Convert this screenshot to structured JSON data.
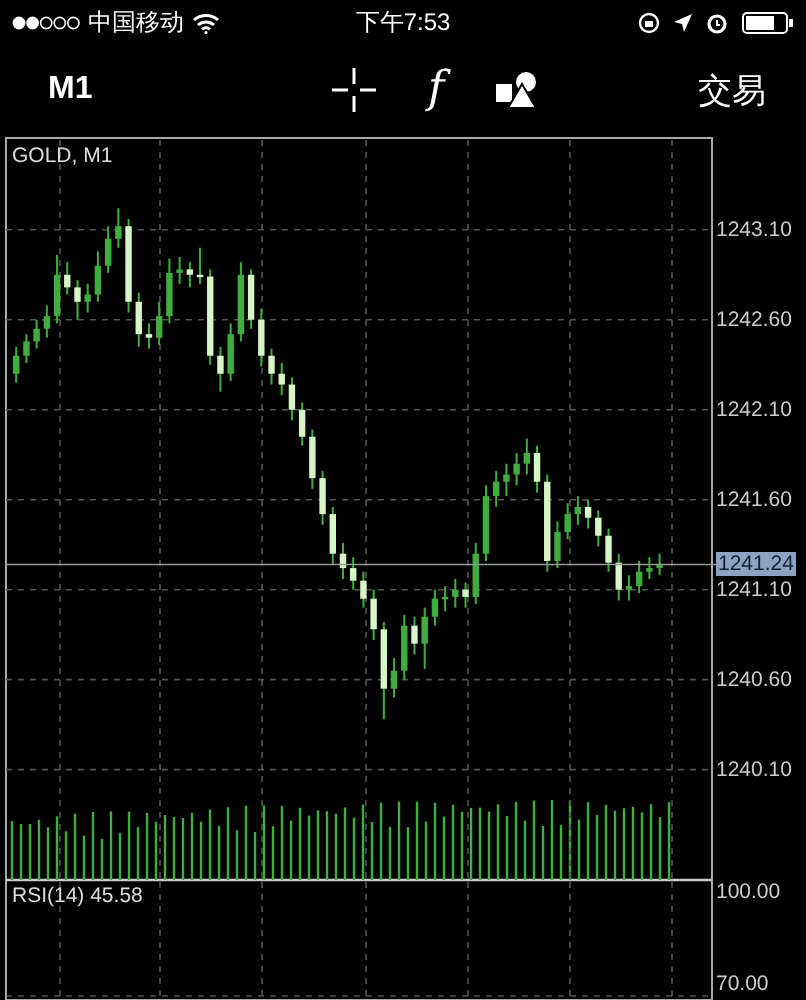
{
  "status_bar": {
    "carrier": "中国移动",
    "time": "下午7:53"
  },
  "toolbar": {
    "timeframe": "M1",
    "function_symbol": "f",
    "trade": "交易"
  },
  "chart": {
    "title": "GOLD, M1",
    "chart_data": {
      "type": "candlestick",
      "ylim": [
        1238.82,
        1243.61
      ],
      "ref_lines": [
        {
          "axis": "y",
          "value": 1241.24,
          "label": "1241.24"
        }
      ],
      "categories": [
        null,
        null,
        null,
        null,
        null,
        null,
        null,
        null,
        null,
        null,
        null,
        null,
        null,
        null,
        null,
        null,
        null,
        null,
        null,
        null,
        null,
        null,
        null,
        null,
        null,
        null,
        null,
        null,
        null,
        null,
        null,
        null,
        null,
        null,
        null,
        null,
        null,
        null,
        null,
        null,
        null,
        null,
        null,
        null,
        null,
        null,
        null,
        null,
        null,
        null,
        null,
        null,
        null,
        null,
        null,
        null,
        null,
        null,
        null,
        null,
        null,
        null,
        null,
        null
      ],
      "ohlc": [
        [
          1242.3,
          1242.45,
          1242.25,
          1242.4
        ],
        [
          1242.4,
          1242.52,
          1242.36,
          1242.48
        ],
        [
          1242.48,
          1242.6,
          1242.44,
          1242.55
        ],
        [
          1242.55,
          1242.68,
          1242.5,
          1242.62
        ],
        [
          1242.62,
          1242.96,
          1242.58,
          1242.85
        ],
        [
          1242.85,
          1242.92,
          1242.74,
          1242.78
        ],
        [
          1242.78,
          1242.82,
          1242.6,
          1242.7
        ],
        [
          1242.7,
          1242.8,
          1242.64,
          1242.74
        ],
        [
          1242.74,
          1242.98,
          1242.7,
          1242.9
        ],
        [
          1242.9,
          1243.12,
          1242.86,
          1243.05
        ],
        [
          1243.05,
          1243.22,
          1243.0,
          1243.12
        ],
        [
          1243.12,
          1243.16,
          1242.64,
          1242.7
        ],
        [
          1242.7,
          1242.75,
          1242.45,
          1242.52
        ],
        [
          1242.52,
          1242.58,
          1242.44,
          1242.5
        ],
        [
          1242.5,
          1242.7,
          1242.46,
          1242.62
        ],
        [
          1242.62,
          1242.94,
          1242.58,
          1242.86
        ],
        [
          1242.86,
          1242.95,
          1242.8,
          1242.88
        ],
        [
          1242.88,
          1242.92,
          1242.78,
          1242.85
        ],
        [
          1242.85,
          1243.0,
          1242.8,
          1242.84
        ],
        [
          1242.84,
          1242.88,
          1242.35,
          1242.4
        ],
        [
          1242.4,
          1242.45,
          1242.2,
          1242.3
        ],
        [
          1242.3,
          1242.58,
          1242.26,
          1242.52
        ],
        [
          1242.52,
          1242.92,
          1242.48,
          1242.85
        ],
        [
          1242.85,
          1242.88,
          1242.55,
          1242.6
        ],
        [
          1242.6,
          1242.66,
          1242.34,
          1242.4
        ],
        [
          1242.4,
          1242.44,
          1242.24,
          1242.3
        ],
        [
          1242.3,
          1242.36,
          1242.18,
          1242.24
        ],
        [
          1242.24,
          1242.28,
          1242.04,
          1242.1
        ],
        [
          1242.1,
          1242.14,
          1241.9,
          1241.95
        ],
        [
          1241.95,
          1241.99,
          1241.66,
          1241.72
        ],
        [
          1241.72,
          1241.76,
          1241.46,
          1241.52
        ],
        [
          1241.52,
          1241.56,
          1241.24,
          1241.3
        ],
        [
          1241.3,
          1241.36,
          1241.16,
          1241.22
        ],
        [
          1241.22,
          1241.28,
          1241.1,
          1241.15
        ],
        [
          1241.15,
          1241.2,
          1241.0,
          1241.05
        ],
        [
          1241.05,
          1241.1,
          1240.82,
          1240.88
        ],
        [
          1240.88,
          1240.92,
          1240.38,
          1240.55
        ],
        [
          1240.55,
          1240.72,
          1240.5,
          1240.65
        ],
        [
          1240.65,
          1240.96,
          1240.6,
          1240.9
        ],
        [
          1240.9,
          1240.95,
          1240.74,
          1240.8
        ],
        [
          1240.8,
          1241.0,
          1240.66,
          1240.95
        ],
        [
          1240.95,
          1241.1,
          1240.9,
          1241.05
        ],
        [
          1241.05,
          1241.12,
          1240.98,
          1241.06
        ],
        [
          1241.06,
          1241.16,
          1241.0,
          1241.1
        ],
        [
          1241.1,
          1241.14,
          1241.0,
          1241.06
        ],
        [
          1241.06,
          1241.36,
          1241.02,
          1241.3
        ],
        [
          1241.3,
          1241.68,
          1241.26,
          1241.62
        ],
        [
          1241.62,
          1241.76,
          1241.56,
          1241.7
        ],
        [
          1241.7,
          1241.8,
          1241.62,
          1241.74
        ],
        [
          1241.74,
          1241.86,
          1241.68,
          1241.8
        ],
        [
          1241.8,
          1241.94,
          1241.74,
          1241.86
        ],
        [
          1241.86,
          1241.9,
          1241.64,
          1241.7
        ],
        [
          1241.7,
          1241.74,
          1241.2,
          1241.26
        ],
        [
          1241.26,
          1241.48,
          1241.22,
          1241.42
        ],
        [
          1241.42,
          1241.58,
          1241.38,
          1241.52
        ],
        [
          1241.52,
          1241.62,
          1241.46,
          1241.56
        ],
        [
          1241.56,
          1241.6,
          1241.44,
          1241.5
        ],
        [
          1241.5,
          1241.54,
          1241.34,
          1241.4
        ],
        [
          1241.4,
          1241.44,
          1241.2,
          1241.25
        ],
        [
          1241.25,
          1241.3,
          1241.04,
          1241.1
        ],
        [
          1241.1,
          1241.18,
          1241.04,
          1241.12
        ],
        [
          1241.12,
          1241.26,
          1241.08,
          1241.2
        ],
        [
          1241.2,
          1241.28,
          1241.16,
          1241.22
        ],
        [
          1241.22,
          1241.3,
          1241.18,
          1241.24
        ]
      ],
      "yticks": [
        {
          "value": 1243.1,
          "label": "1243.10"
        },
        {
          "value": 1242.6,
          "label": "1242.60"
        },
        {
          "value": 1242.1,
          "label": "1242.10"
        },
        {
          "value": 1241.6,
          "label": "1241.60"
        },
        {
          "value": 1241.1,
          "label": "1241.10"
        },
        {
          "value": 1240.6,
          "label": "1240.60"
        },
        {
          "value": 1240.1,
          "label": "1240.10"
        }
      ],
      "xlabel": null,
      "grid": true
    },
    "indicator": "RSI(14) 45.58",
    "indicator_labels": [
      "100.00",
      "70.00"
    ]
  }
}
